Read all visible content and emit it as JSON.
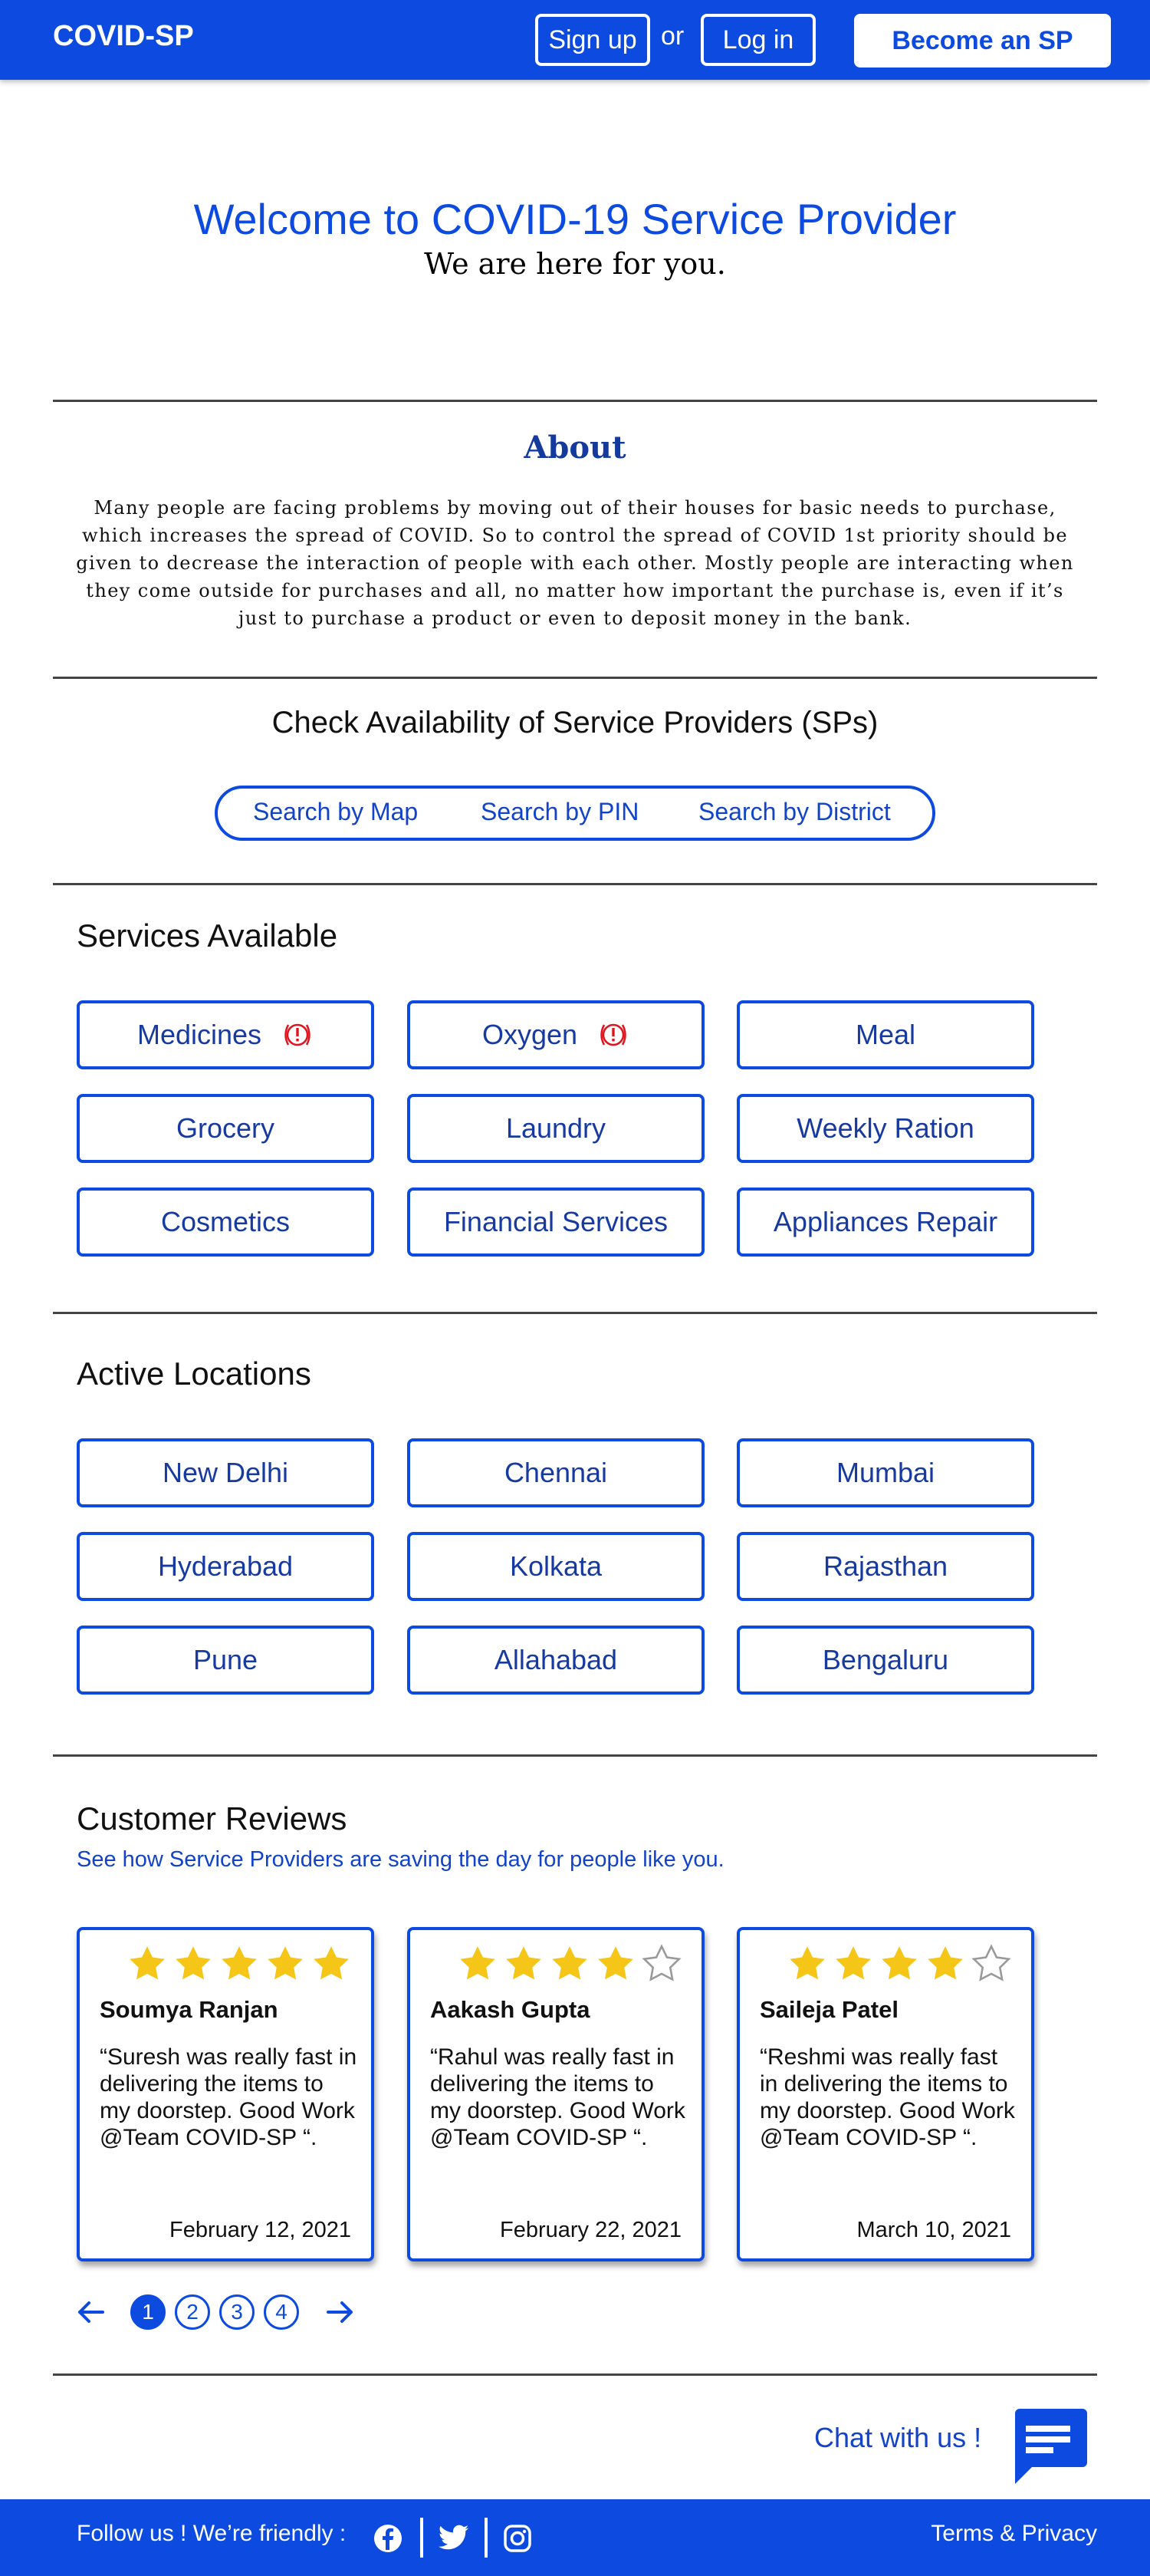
{
  "header": {
    "brand": "COVID-SP",
    "signup_label": "Sign up",
    "or_text": "or",
    "login_label": "Log in",
    "become_label": "Become an SP"
  },
  "hero": {
    "title": "Welcome to COVID-19 Service Provider",
    "subtitle": "We are here for you."
  },
  "about": {
    "title": "About",
    "text": "Many people are facing problems by moving out of their houses for basic needs to purchase, which increases the spread of COVID. So to control the spread of COVID 1st priority should be given to decrease the interaction of people with each other. Mostly people are interacting when they come outside for purchases and all, no matter how important the purchase is, even if it’s just to purchase a product or even to deposit money in the bank."
  },
  "availability": {
    "title": "Check Availability of Service Providers (SPs)",
    "options": [
      "Search by Map",
      "Search by PIN",
      "Search by District"
    ]
  },
  "services": {
    "title": "Services Available",
    "items": [
      {
        "label": "Medicines",
        "alert": true
      },
      {
        "label": "Oxygen",
        "alert": true
      },
      {
        "label": "Meal",
        "alert": false
      },
      {
        "label": "Grocery",
        "alert": false
      },
      {
        "label": "Laundry",
        "alert": false
      },
      {
        "label": "Weekly Ration",
        "alert": false
      },
      {
        "label": "Cosmetics",
        "alert": false
      },
      {
        "label": "Financial Services",
        "alert": false
      },
      {
        "label": "Appliances Repair",
        "alert": false
      }
    ]
  },
  "locations": {
    "title": "Active Locations",
    "items": [
      "New Delhi",
      "Chennai",
      "Mumbai",
      "Hyderabad",
      "Kolkata",
      "Rajasthan",
      "Pune",
      "Allahabad",
      "Bengaluru"
    ]
  },
  "reviews": {
    "title": "Customer Reviews",
    "subtitle": "See how Service Providers are saving the day for people like you.",
    "cards": [
      {
        "name": "Soumya Ranjan",
        "rating": 5,
        "text": "“Suresh was really fast in delivering the items to my doorstep. Good Work @Team COVID-SP “.",
        "date": "February 12, 2021"
      },
      {
        "name": "Aakash Gupta",
        "rating": 4,
        "text": "“Rahul was really fast in delivering the items to my doorstep. Good Work @Team COVID-SP “.",
        "date": "February 22, 2021"
      },
      {
        "name": "Saileja Patel",
        "rating": 4,
        "text": "“Reshmi was really fast in delivering the items to my doorstep. Good Work @Team COVID-SP “.",
        "date": "March 10, 2021"
      }
    ],
    "pages": [
      "1",
      "2",
      "3",
      "4"
    ],
    "current_page": 1
  },
  "chat": {
    "label": "Chat with us !"
  },
  "footer": {
    "follow_text": "Follow us !  We’re friendly :",
    "social_icons": [
      "facebook-icon",
      "twitter-icon",
      "instagram-icon"
    ],
    "terms_label": "Terms & Privacy"
  },
  "colors": {
    "primary": "#0d4be0",
    "heading_blue": "#133a9c",
    "star": "#f5c518",
    "alert_red": "#e0141e"
  }
}
